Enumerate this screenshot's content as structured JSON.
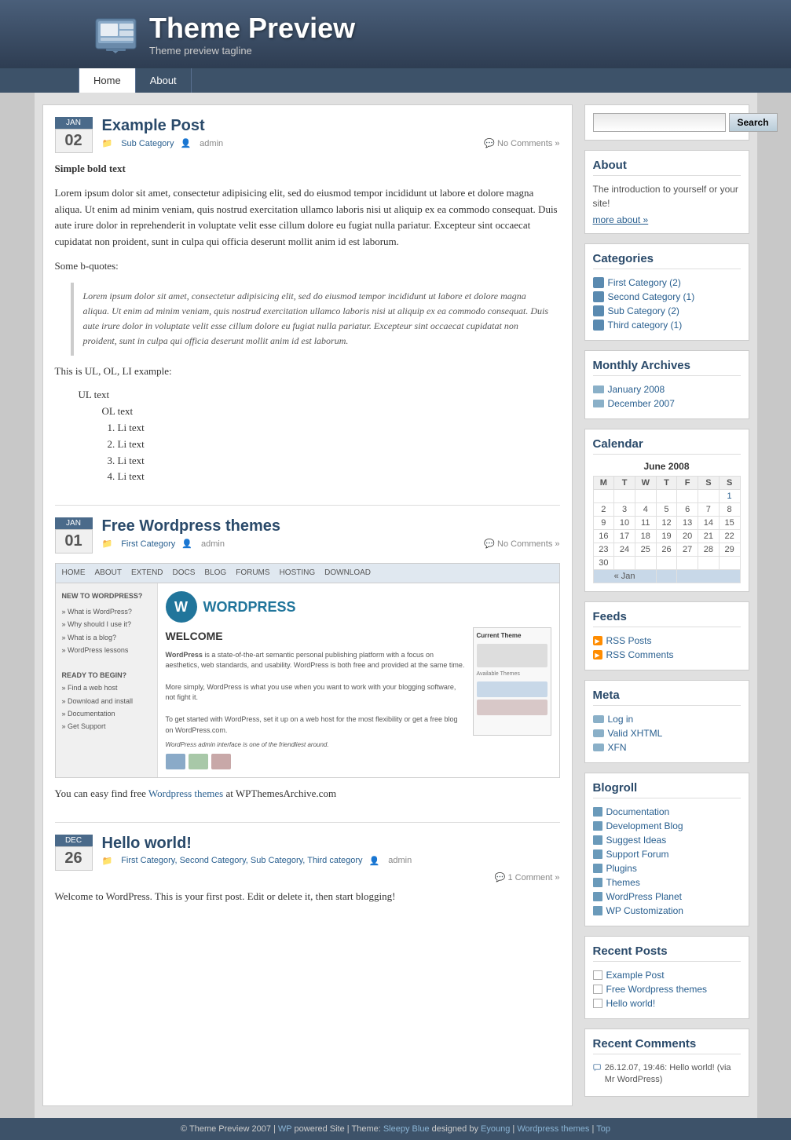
{
  "site": {
    "title": "Theme Preview",
    "tagline": "Theme preview tagline",
    "footer_text": "© Theme Preview 2007 |",
    "footer_wp": "WP",
    "footer_powered": " powered Site | Theme: ",
    "footer_theme": "Sleepy Blue",
    "footer_designed": " designed by ",
    "footer_author": "Eyoung",
    "footer_separator": " | ",
    "footer_wp_themes": "Wordpress themes",
    "footer_sep2": " | ",
    "footer_top": "Top"
  },
  "nav": {
    "items": [
      {
        "label": "Home",
        "active": true
      },
      {
        "label": "About",
        "active": false
      }
    ]
  },
  "posts": [
    {
      "id": "post1",
      "month": "JAN",
      "day": "02",
      "title": "Example Post",
      "category": "Sub Category",
      "author": "admin",
      "comments": "No Comments »",
      "bold_title": "Simple bold text",
      "body_p1": "Lorem ipsum dolor sit amet, consectetur adipisicing elit, sed do eiusmod tempor incididunt ut labore et dolore magna aliqua. Ut enim ad minim veniam, quis nostrud exercitation ullamco laboris nisi ut aliquip ex ea commodo consequat. Duis aute irure dolor in reprehenderit in voluptate velit esse cillum dolore eu fugiat nulla pariatur. Excepteur sint occaecat cupidatat non proident, sunt in culpa qui officia deserunt mollit anim id est laborum.",
      "bquote_label": "Some b-quotes:",
      "blockquote": "Lorem ipsum dolor sit amet, consectetur adipisicing elit, sed do eiusmod tempor incididunt ut labore et dolore magna aliqua. Ut enim ad minim veniam, quis nostrud exercitation ullamco laboris nisi ut aliquip ex ea commodo consequat. Duis aute irure dolor in voluptate velit esse cillum dolore eu fugiat nulla pariatur. Excepteur sint occaecat cupidatat non proident, sunt in culpa qui officia deserunt mollit anim id est laborum.",
      "ul_label": "This is UL, OL, LI example:",
      "ul_text": "UL text",
      "ol_text": "OL text",
      "li_items": [
        "Li text",
        "Li text",
        "Li text",
        "Li text"
      ]
    },
    {
      "id": "post2",
      "month": "JAN",
      "day": "01",
      "title": "Free Wordpress themes",
      "category": "First Category",
      "author": "admin",
      "comments": "No Comments »",
      "body_text": "You can easy find free ",
      "body_link": "Wordpress themes",
      "body_text2": " at WPThemesArchive.com"
    },
    {
      "id": "post3",
      "month": "DEC",
      "day": "26",
      "title": "Hello world!",
      "categories": "First Category, Second Category, Sub Category, Third category",
      "author": "admin",
      "comments": "1 Comment »",
      "body": "Welcome to WordPress. This is your first post. Edit or delete it, then start blogging!"
    }
  ],
  "sidebar": {
    "search": {
      "placeholder": "",
      "button": "Search"
    },
    "about": {
      "title": "About",
      "intro": "The introduction to yourself or your site!",
      "more": "more about »"
    },
    "categories": {
      "title": "Categories",
      "items": [
        {
          "label": "First Category (2)"
        },
        {
          "label": "Second Category (1)"
        },
        {
          "label": "Sub Category (2)"
        },
        {
          "label": "Third category (1)"
        }
      ]
    },
    "monthly_archives": {
      "title": "Monthly Archives",
      "items": [
        {
          "label": "January 2008"
        },
        {
          "label": "December 2007"
        }
      ]
    },
    "calendar": {
      "title": "Calendar",
      "month_year": "June 2008",
      "days": [
        "M",
        "T",
        "W",
        "T",
        "F",
        "S",
        "S"
      ],
      "rows": [
        [
          "",
          "",
          "",
          "",
          "",
          "",
          "1"
        ],
        [
          "2",
          "3",
          "4",
          "5",
          "6",
          "7",
          "8"
        ],
        [
          "9",
          "10",
          "11",
          "12",
          "13",
          "14",
          "15"
        ],
        [
          "16",
          "17",
          "18",
          "19",
          "20",
          "21",
          "22"
        ],
        [
          "23",
          "24",
          "25",
          "26",
          "27",
          "28",
          "29"
        ],
        [
          "30",
          "",
          "",
          "",
          "",
          "",
          ""
        ]
      ],
      "nav_prev": "« Jan",
      "nav_next": ""
    },
    "feeds": {
      "title": "Feeds",
      "items": [
        {
          "label": "RSS Posts"
        },
        {
          "label": "RSS Comments"
        }
      ]
    },
    "meta": {
      "title": "Meta",
      "items": [
        {
          "label": "Log in"
        },
        {
          "label": "Valid XHTML"
        },
        {
          "label": "XFN"
        }
      ]
    },
    "blogroll": {
      "title": "Blogroll",
      "items": [
        {
          "label": "Documentation"
        },
        {
          "label": "Development Blog"
        },
        {
          "label": "Suggest Ideas"
        },
        {
          "label": "Support Forum"
        },
        {
          "label": "Plugins"
        },
        {
          "label": "Themes"
        },
        {
          "label": "WordPress Planet"
        },
        {
          "label": "WP Customization"
        }
      ]
    },
    "recent_posts": {
      "title": "Recent Posts",
      "items": [
        {
          "label": "Example Post"
        },
        {
          "label": "Free Wordpress themes"
        },
        {
          "label": "Hello world!"
        }
      ]
    },
    "recent_comments": {
      "title": "Recent Comments",
      "items": [
        {
          "text": "26.12.07, 19:46: Hello world! (via Mr WordPress)"
        }
      ]
    }
  }
}
